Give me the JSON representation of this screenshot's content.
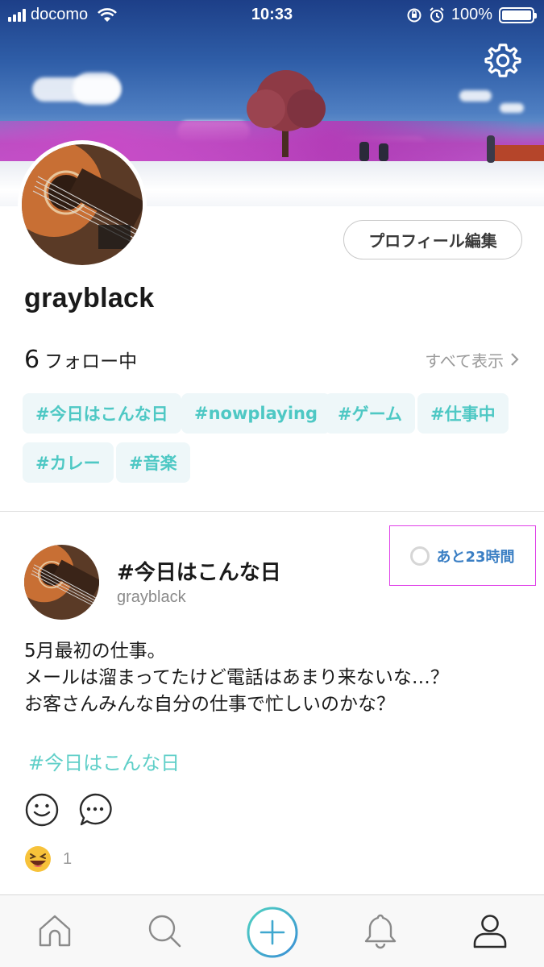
{
  "status_bar": {
    "carrier": "docomo",
    "time": "10:33",
    "battery": "100%"
  },
  "profile": {
    "username": "grayblack",
    "edit_button": "プロフィール編集",
    "follow_count": "6",
    "follow_label": "フォロー中",
    "show_all": "すべて表示"
  },
  "tags": [
    "#今日はこんな日",
    "#nowplaying",
    "#ゲーム",
    "#仕事中",
    "#カレー",
    "#音楽"
  ],
  "post": {
    "title": "#今日はこんな日",
    "author": "grayblack",
    "time_left": "あと23時間",
    "body": [
      "5月最初の仕事。",
      "メールは溜まってたけど電話はあまり来ないな…？",
      "お客さんみんな自分の仕事で忙しいのかな？"
    ],
    "hashtag": "#今日はこんな日",
    "reaction_count": "1"
  },
  "icons": {
    "settings": "gear-icon",
    "react": "smiley-icon",
    "comment": "comment-icon",
    "reaction": "laughing-emoji-icon",
    "tabs": [
      "home-icon",
      "search-icon",
      "plus-icon",
      "bell-icon",
      "profile-icon"
    ]
  },
  "colors": {
    "accent_teal": "#4ec8c4",
    "tag_background": "#eef7f9",
    "timer_blue": "#3b7fc4",
    "highlight_magenta": "#e040e8"
  }
}
